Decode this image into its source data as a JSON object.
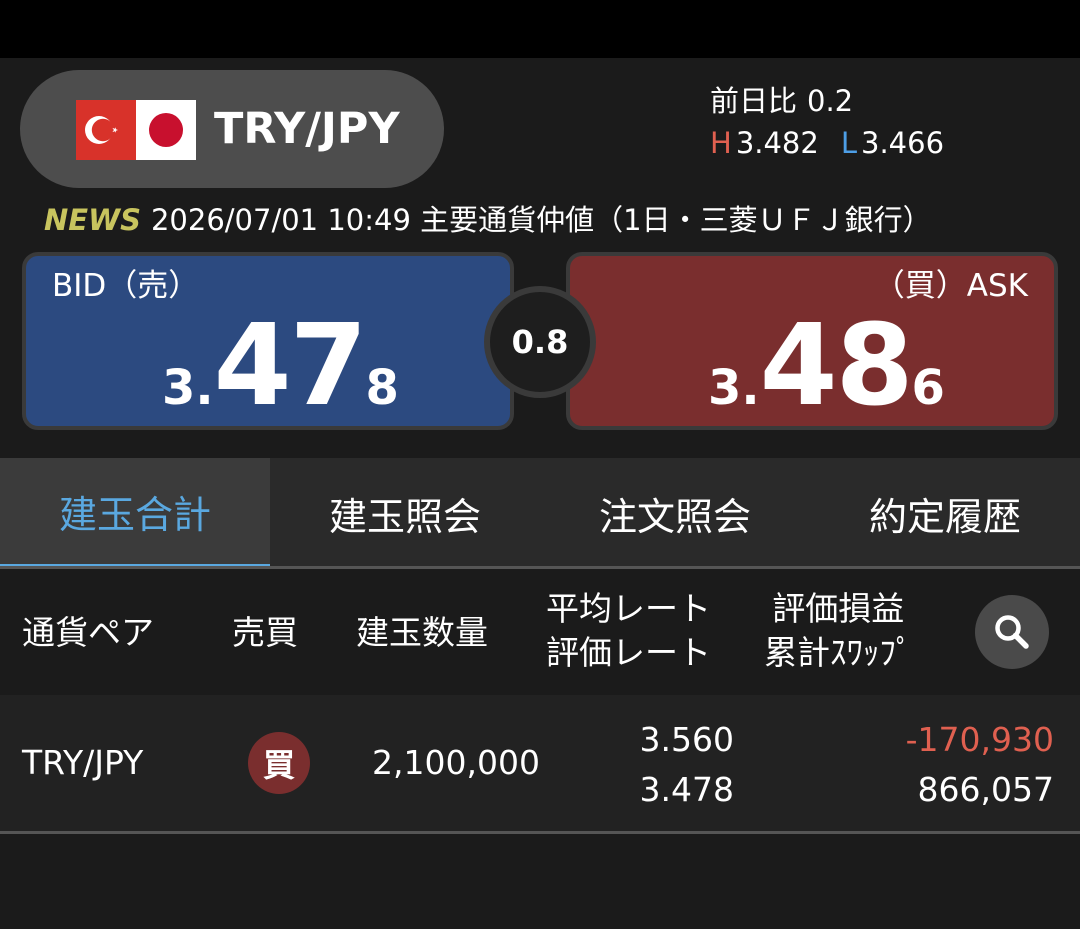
{
  "header": {
    "pair": "TRY/JPY",
    "prev_day_label": "前日比",
    "prev_day_value": "0.2",
    "high_label": "H",
    "high_value": "3.482",
    "low_label": "L",
    "low_value": "3.466"
  },
  "news": {
    "tag": "NEWS",
    "text": "2026/07/01 10:49 主要通貨仲値（1日・三菱ＵＦＪ銀行）"
  },
  "bid": {
    "label": "BID（売）",
    "price_prefix": "3.",
    "price_main": "47",
    "price_tail": "8"
  },
  "ask": {
    "label": "（買）ASK",
    "price_prefix": "3.",
    "price_main": "48",
    "price_tail": "6"
  },
  "spread": "0.8",
  "tabs": [
    {
      "label": "建玉合計",
      "active": true
    },
    {
      "label": "建玉照会",
      "active": false
    },
    {
      "label": "注文照会",
      "active": false
    },
    {
      "label": "約定履歴",
      "active": false
    }
  ],
  "table": {
    "headers": {
      "pair": "通貨ペア",
      "side": "売買",
      "qty": "建玉数量",
      "rate_top": "平均レート",
      "rate_bottom": "評価レート",
      "pl_top": "評価損益",
      "pl_bottom": "累計ｽﾜｯﾌﾟ"
    },
    "rows": [
      {
        "pair": "TRY/JPY",
        "side": "買",
        "qty": "2,100,000",
        "avg_rate": "3.560",
        "eval_rate": "3.478",
        "pl": "-170,930",
        "swap": "866,057"
      }
    ]
  },
  "colors": {
    "bid_panel": "#2c4a80",
    "ask_panel": "#7a2e2e",
    "active_tab": "#5aa8e0",
    "negative": "#e06050",
    "news_tag": "#c8c45e"
  },
  "icons": {
    "search": "search-icon",
    "flag_base": "turkey-flag-icon",
    "flag_quote": "japan-flag-icon"
  }
}
